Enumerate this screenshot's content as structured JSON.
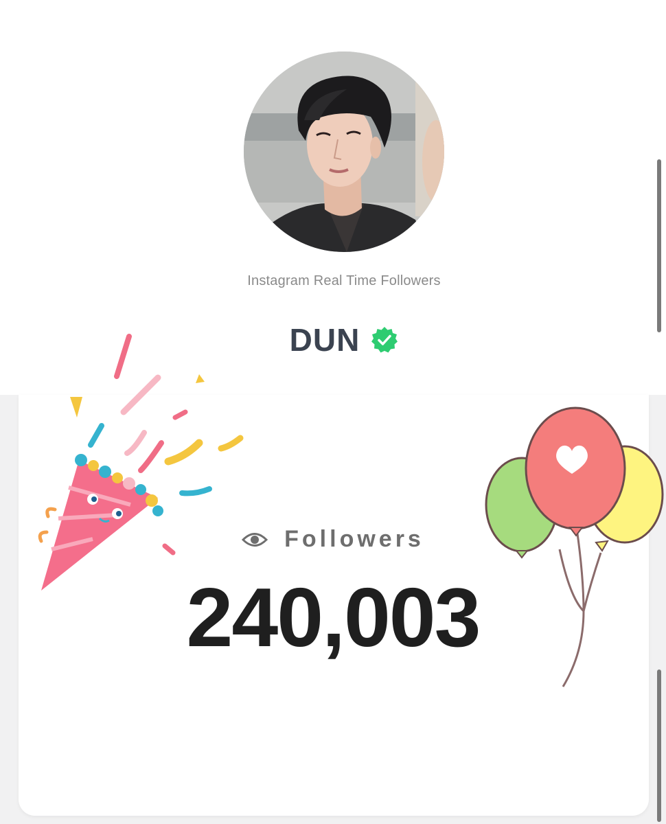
{
  "profile": {
    "subtitle": "Instagram Real Time Followers",
    "name": "DUN",
    "verified_icon": "verified-badge-icon",
    "verified_color": "#2ecc71"
  },
  "stats": {
    "icon": "eye-icon",
    "label": "Followers",
    "count": "240,003"
  },
  "colors": {
    "name_text": "#3b4350",
    "count_text": "#1f1f1f",
    "label_text": "#6e6e6e"
  }
}
